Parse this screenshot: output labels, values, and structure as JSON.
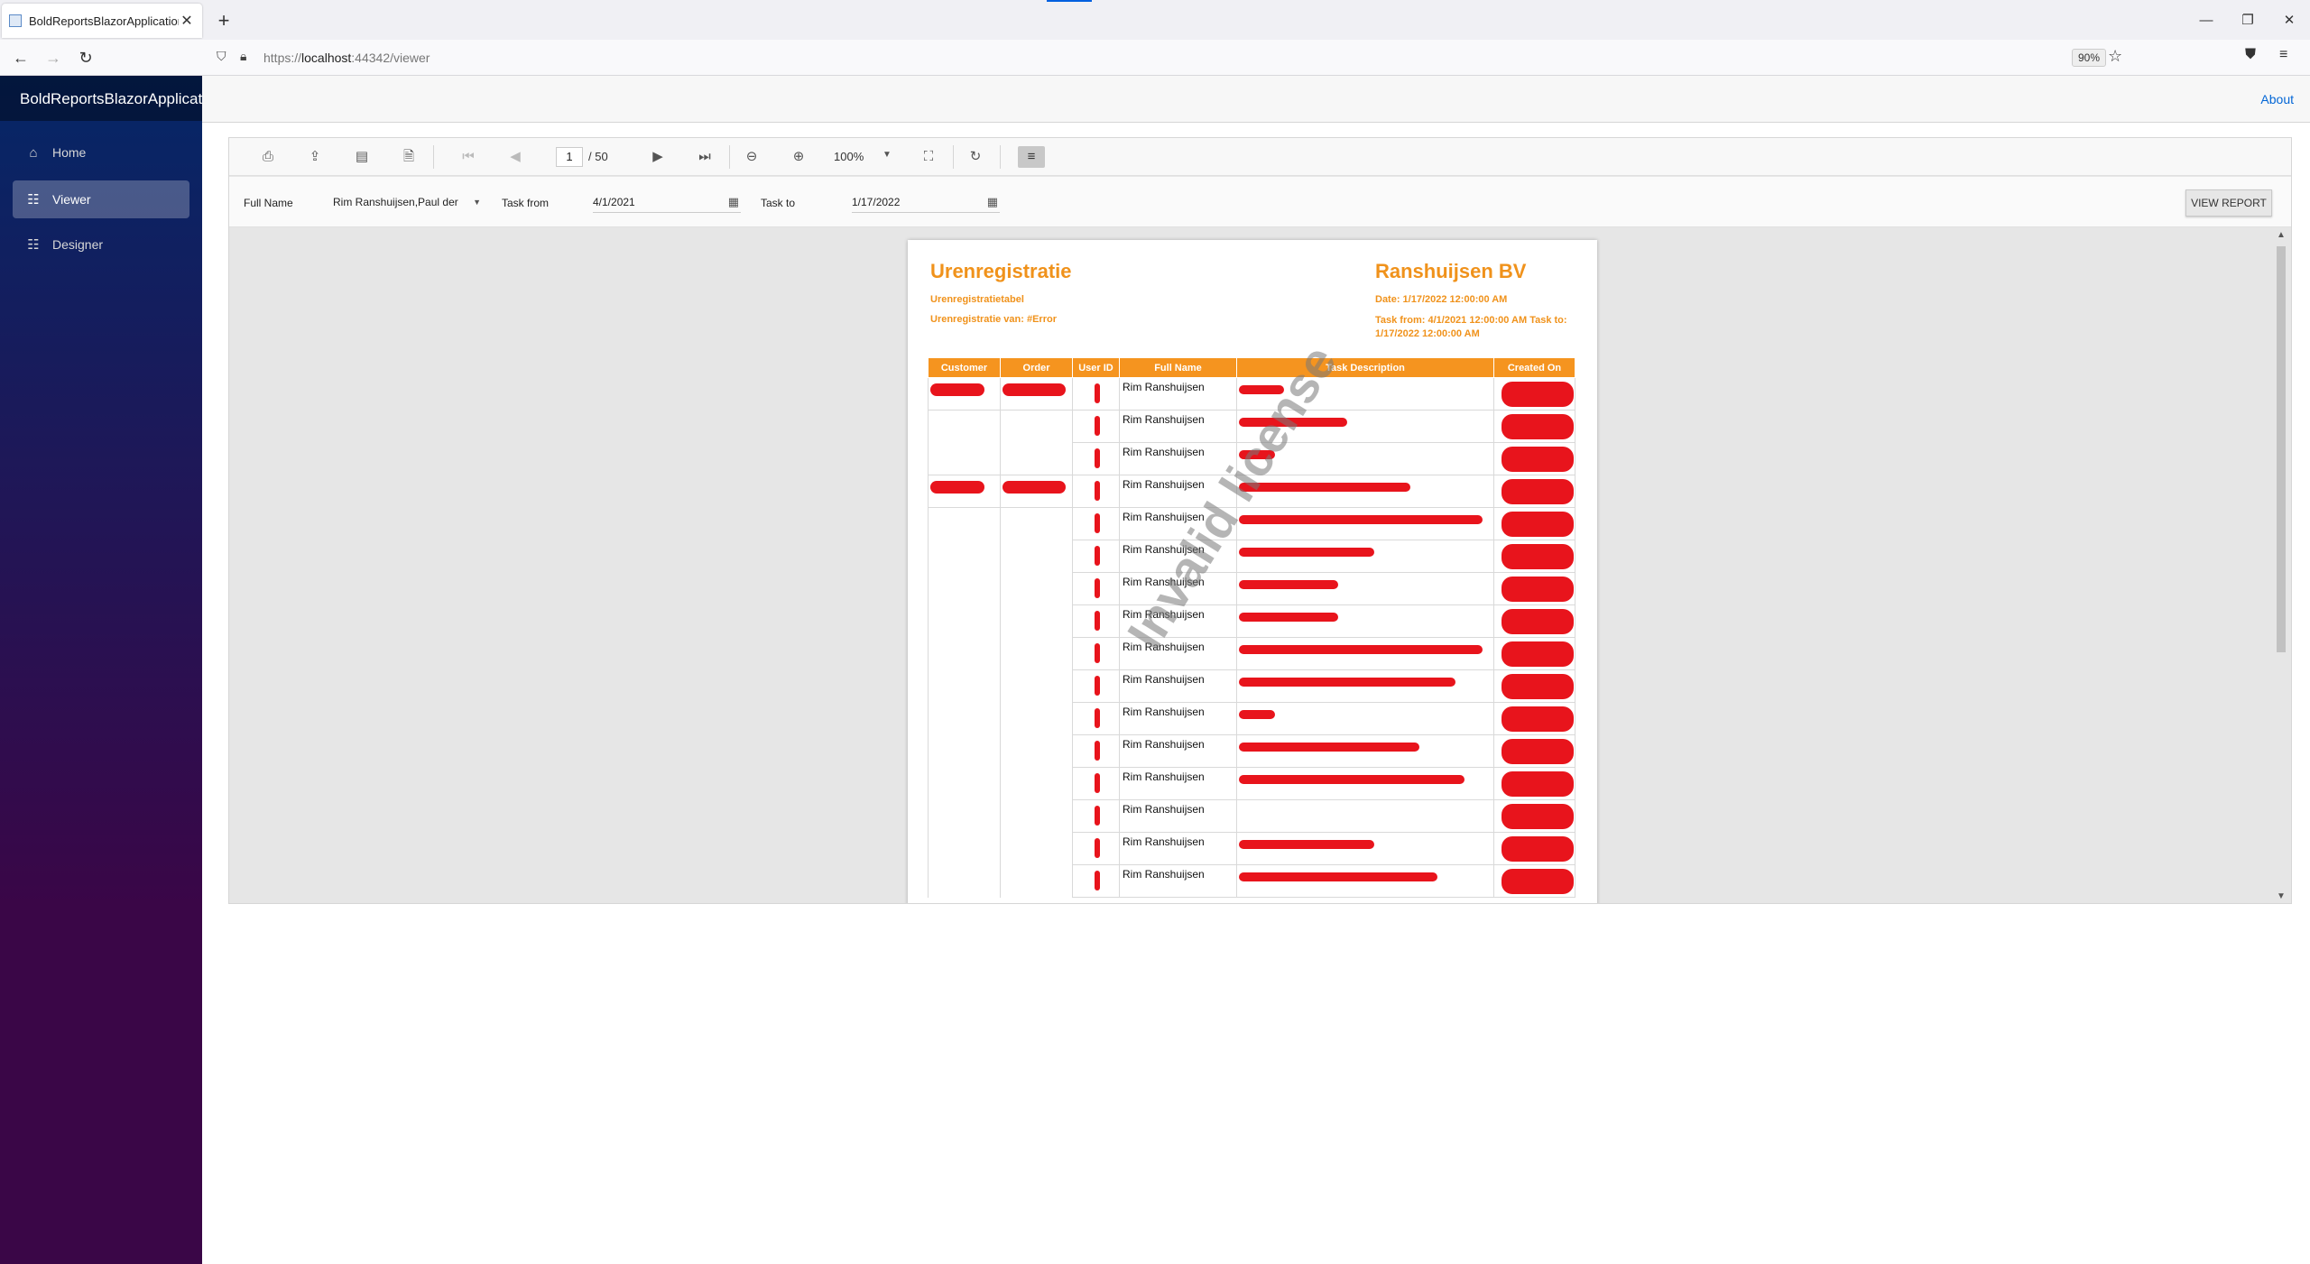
{
  "browser": {
    "tab_title": "BoldReportsBlazorApplication",
    "url_prefix": "https://",
    "url_host": "localhost",
    "url_path": ":44342/viewer",
    "zoom": "90%"
  },
  "app": {
    "brand": "BoldReportsBlazorApplication",
    "about": "About",
    "nav": [
      {
        "label": "Home"
      },
      {
        "label": "Viewer"
      },
      {
        "label": "Designer"
      }
    ]
  },
  "toolbar": {
    "page_current": "1",
    "page_total": "/ 50",
    "zoom": "100%"
  },
  "params": {
    "full_name_label": "Full Name",
    "full_name_value": "Rim Ranshuijsen,Paul der",
    "task_from_label": "Task from",
    "task_from_value": "4/1/2021",
    "task_to_label": "Task to",
    "task_to_value": "1/17/2022",
    "view_report": "VIEW REPORT"
  },
  "report": {
    "title": "Urenregistratie",
    "subtitle1": "Urenregistratietabel",
    "subtitle2": "Urenregistratie van: #Error",
    "company": "Ranshuijsen BV",
    "date": "Date: 1/17/2022 12:00:00 AM",
    "task_range": "Task from: 4/1/2021 12:00:00 AM Task to: 1/17/2022 12:00:00 AM",
    "watermark": "Invalid license",
    "columns": [
      "Customer",
      "Order",
      "User ID",
      "Full Name",
      "Task Description",
      "Created On"
    ],
    "row_name": "Rim Ranshuijsen",
    "rows": 16
  },
  "colors": {
    "accent_orange": "#f5941f",
    "redaction": "#e8141c",
    "sidebar_top": "#052767",
    "sidebar_bottom": "#3a0647",
    "link_blue": "#0366d6"
  }
}
